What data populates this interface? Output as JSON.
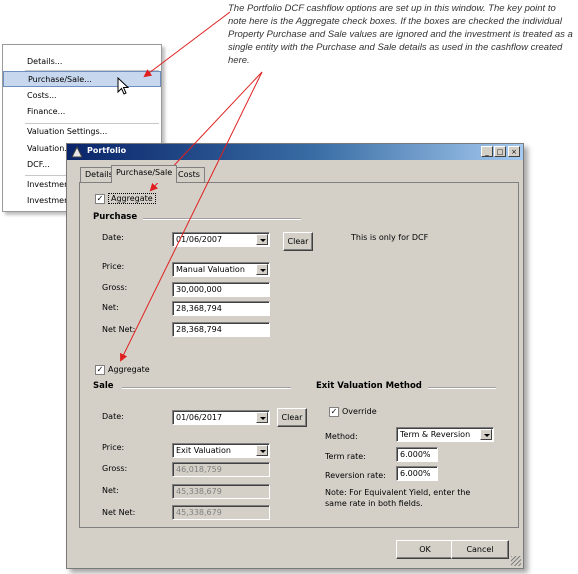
{
  "annotation": "The Portfolio DCF cashflow options are set up in this window. The key point to note here is the Aggregate check boxes. If the boxes are checked the individual Property Purchase and Sale values are ignored and the investment is treated as a single entity with the Purchase and Sale details as used in the cashflow created here.",
  "menu": {
    "items": [
      "Details...",
      "Purchase/Sale...",
      "Costs...",
      "Finance...",
      "Valuation Settings...",
      "Valuation...",
      "DCF...",
      "Investment",
      "Investment"
    ],
    "selected": "Purchase/Sale..."
  },
  "window": {
    "title": "Portfolio",
    "controls": [
      "_",
      "□",
      "×"
    ],
    "tabs": [
      "Details",
      "Purchase/Sale",
      "Costs"
    ],
    "active_tab": "Purchase/Sale"
  },
  "purchase": {
    "aggregate_label": "Aggregate",
    "aggregate_checked": true,
    "header": "Purchase",
    "date_label": "Date:",
    "date_value": "01/06/2007",
    "clear_label": "Clear",
    "dcf_note": "This is only for DCF",
    "price_label": "Price:",
    "price_value": "Manual Valuation",
    "gross_label": "Gross:",
    "gross_value": "30,000,000",
    "net_label": "Net:",
    "net_value": "28,368,794",
    "netnet_label": "Net Net:",
    "netnet_value": "28,368,794"
  },
  "sale": {
    "aggregate_label": "Aggregate",
    "aggregate_checked": true,
    "header": "Sale",
    "date_label": "Date:",
    "date_value": "01/06/2017",
    "clear_label": "Clear",
    "price_label": "Price:",
    "price_value": "Exit Valuation",
    "gross_label": "Gross:",
    "gross_value": "46,018,759",
    "net_label": "Net:",
    "net_value": "45,338,679",
    "netnet_label": "Net Net:",
    "netnet_value": "45,338,679"
  },
  "exit": {
    "header": "Exit Valuation Method",
    "override_label": "Override",
    "override_checked": true,
    "method_label": "Method:",
    "method_value": "Term & Reversion",
    "term_label": "Term rate:",
    "term_value": "6.000%",
    "reversion_label": "Reversion rate:",
    "reversion_value": "6.000%",
    "note": "Note: For Equivalent Yield, enter the same rate in both fields."
  },
  "footer": {
    "ok_label": "OK",
    "cancel_label": "Cancel"
  },
  "colors": {
    "arrow": "#e02020",
    "titlebar": "#0a246a",
    "dialog_bg": "#d4d0c8"
  }
}
